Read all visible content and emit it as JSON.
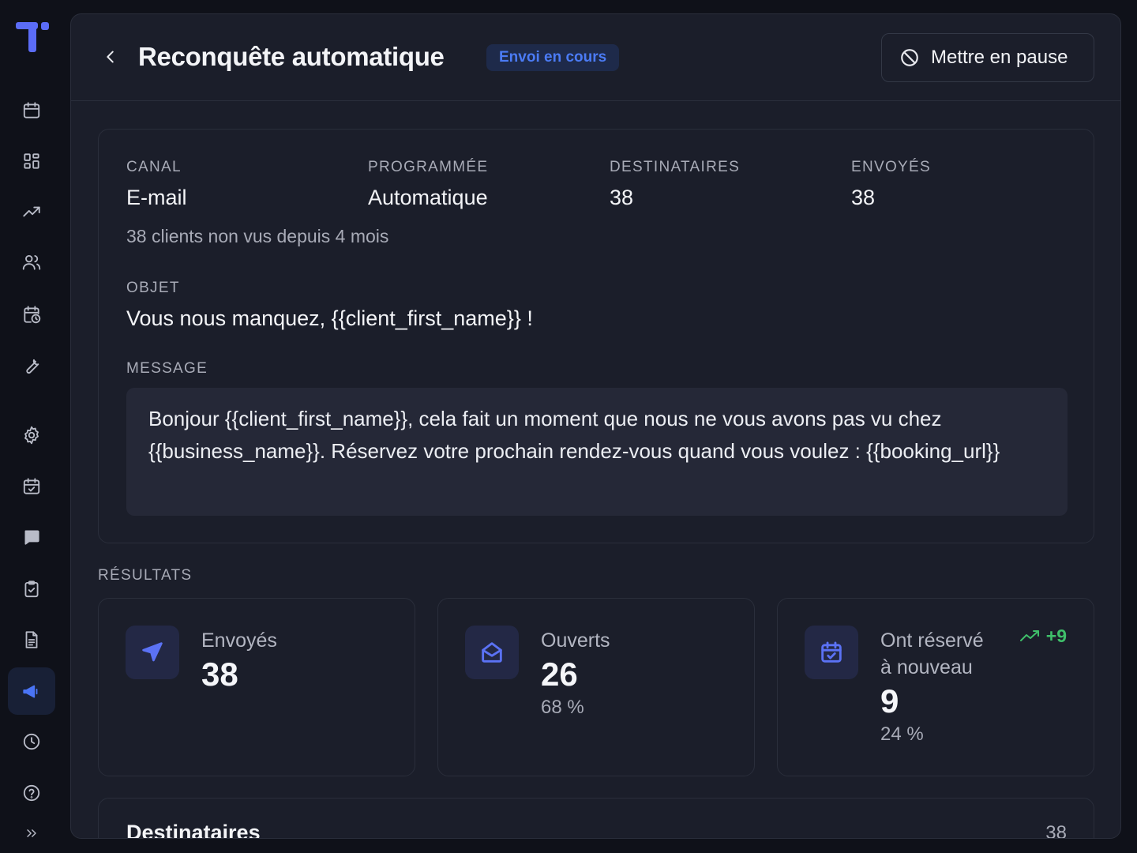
{
  "header": {
    "title": "Reconquête automatique",
    "status": "Envoi en cours",
    "pause_label": "Mettre en pause"
  },
  "details": {
    "channel_label": "CANAL",
    "channel_value": "E-mail",
    "scheduled_label": "PROGRAMMÉE",
    "scheduled_value": "Automatique",
    "recipients_label": "DESTINATAIRES",
    "recipients_value": "38",
    "sent_label": "ENVOYÉS",
    "sent_value": "38",
    "audience": "38 clients non vus depuis 4 mois",
    "subject_label": "OBJET",
    "subject_value": "Vous nous manquez, {{client_first_name}} !",
    "message_label": "MESSAGE",
    "message_value": "Bonjour {{client_first_name}}, cela fait un moment que nous ne vous avons pas vu chez {{business_name}}. Réservez votre prochain rendez-vous quand vous voulez : {{booking_url}}"
  },
  "results": {
    "section_label": "RÉSULTATS",
    "cards": [
      {
        "label": "Envoyés",
        "value": "38",
        "icon": "send-icon"
      },
      {
        "label": "Ouverts",
        "value": "26",
        "percent": "68 %",
        "icon": "mail-open-icon"
      },
      {
        "label": "Ont réservé à nouveau",
        "value": "9",
        "percent": "24 %",
        "trend": "+9",
        "icon": "calendar-check-icon"
      }
    ]
  },
  "recipients": {
    "title": "Destinataires",
    "count": "38"
  },
  "colors": {
    "accent": "#4b7bf5",
    "positive": "#3fbf6a",
    "background": "#0f1119",
    "panel": "#1b1e2a"
  }
}
